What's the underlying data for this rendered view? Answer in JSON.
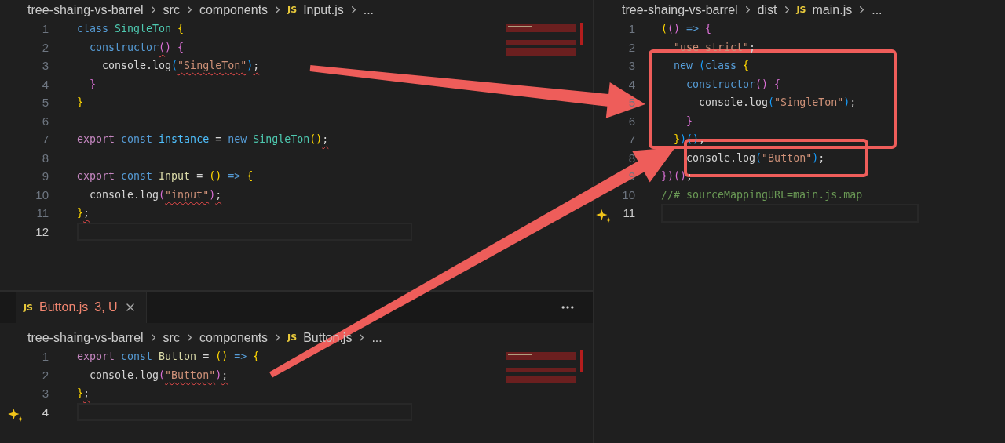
{
  "panes": [
    {
      "breadcrumb": [
        {
          "text": "tree-shaing-vs-barrel"
        },
        {
          "text": "src"
        },
        {
          "text": "components"
        },
        {
          "text": "Input.js",
          "file": "JS"
        },
        {
          "text": "..."
        }
      ],
      "minimap": true,
      "lines": [
        {
          "number": "1",
          "tokens": [
            {
              "text": "class ",
              "kind": "kw"
            },
            {
              "text": "SingleTon ",
              "kind": "cls"
            },
            {
              "text": "{",
              "kind": "p1"
            }
          ]
        },
        {
          "number": "2",
          "tokens": [
            {
              "text": "  constructor",
              "kind": "kw"
            },
            {
              "text": "(",
              "kind": "p2",
              "error": true
            },
            {
              "text": ") {",
              "kind": "p2"
            }
          ]
        },
        {
          "number": "3",
          "tokens": [
            {
              "text": "    console.log",
              "kind": "plain"
            },
            {
              "text": "(",
              "kind": "p3"
            },
            {
              "text": "\"SingleTon\"",
              "kind": "str",
              "error": true
            },
            {
              "text": ")",
              "kind": "p3"
            },
            {
              "text": ";",
              "kind": "plain",
              "error": true
            }
          ]
        },
        {
          "number": "4",
          "tokens": [
            {
              "text": "  }",
              "kind": "p2"
            }
          ]
        },
        {
          "number": "5",
          "tokens": [
            {
              "text": "}",
              "kind": "p1"
            }
          ]
        },
        {
          "number": "6"
        },
        {
          "number": "7",
          "tokens": [
            {
              "text": "export ",
              "kind": "ctrl"
            },
            {
              "text": "const ",
              "kind": "kw"
            },
            {
              "text": "instance",
              "kind": "var"
            },
            {
              "text": " = ",
              "kind": "plain"
            },
            {
              "text": "new ",
              "kind": "kw"
            },
            {
              "text": "SingleTon",
              "kind": "cls"
            },
            {
              "text": "()",
              "kind": "p1"
            },
            {
              "text": ";",
              "kind": "plain",
              "error": true
            }
          ]
        },
        {
          "number": "8"
        },
        {
          "number": "9",
          "tokens": [
            {
              "text": "export ",
              "kind": "ctrl"
            },
            {
              "text": "const ",
              "kind": "kw"
            },
            {
              "text": "Input",
              "kind": "fn"
            },
            {
              "text": " = ",
              "kind": "plain"
            },
            {
              "text": "() ",
              "kind": "p1"
            },
            {
              "text": "=> ",
              "kind": "kw"
            },
            {
              "text": "{",
              "kind": "p1"
            }
          ]
        },
        {
          "number": "10",
          "tokens": [
            {
              "text": "  console.log",
              "kind": "plain"
            },
            {
              "text": "(",
              "kind": "p2"
            },
            {
              "text": "\"input\"",
              "kind": "str",
              "error": true
            },
            {
              "text": ")",
              "kind": "p2"
            },
            {
              "text": ";",
              "kind": "plain",
              "error": true
            }
          ]
        },
        {
          "number": "11",
          "tokens": [
            {
              "text": "}",
              "kind": "p1"
            },
            {
              "text": ";",
              "kind": "plain",
              "error": true
            }
          ]
        },
        {
          "number": "12",
          "current": true
        }
      ]
    },
    {
      "tab": {
        "icon": "JS",
        "name": "Button.js",
        "badge": "3, U",
        "selected": true
      },
      "breadcrumb": [
        {
          "text": "tree-shaing-vs-barrel"
        },
        {
          "text": "src"
        },
        {
          "text": "components"
        },
        {
          "text": "Button.js",
          "file": "JS"
        },
        {
          "text": "..."
        }
      ],
      "minimap": true,
      "lines": [
        {
          "number": "1",
          "tokens": [
            {
              "text": "export ",
              "kind": "ctrl"
            },
            {
              "text": "const ",
              "kind": "kw"
            },
            {
              "text": "Button",
              "kind": "fn"
            },
            {
              "text": " = ",
              "kind": "plain"
            },
            {
              "text": "() ",
              "kind": "p1"
            },
            {
              "text": "=> ",
              "kind": "kw"
            },
            {
              "text": "{",
              "kind": "p1"
            }
          ]
        },
        {
          "number": "2",
          "tokens": [
            {
              "text": "  console.log",
              "kind": "plain"
            },
            {
              "text": "(",
              "kind": "p2"
            },
            {
              "text": "\"Button\"",
              "kind": "str",
              "error": true
            },
            {
              "text": ")",
              "kind": "p2"
            },
            {
              "text": ";",
              "kind": "plain",
              "error": true
            }
          ]
        },
        {
          "number": "3",
          "tokens": [
            {
              "text": "}",
              "kind": "p1"
            },
            {
              "text": ";",
              "kind": "plain",
              "error": true
            }
          ]
        },
        {
          "number": "4",
          "current": true,
          "sparkle": true
        }
      ]
    },
    {
      "breadcrumb": [
        {
          "text": "tree-shaing-vs-barrel"
        },
        {
          "text": "dist"
        },
        {
          "text": "main.js",
          "file": "JS"
        },
        {
          "text": "..."
        }
      ],
      "lines": [
        {
          "number": "1",
          "tokens": [
            {
              "text": "(",
              "kind": "p1"
            },
            {
              "text": "() ",
              "kind": "p2"
            },
            {
              "text": "=> ",
              "kind": "kw"
            },
            {
              "text": "{",
              "kind": "p2"
            }
          ]
        },
        {
          "number": "2",
          "tokens": [
            {
              "text": "  \"use strict\"",
              "kind": "str"
            },
            {
              "text": ";",
              "kind": "plain"
            }
          ]
        },
        {
          "number": "3",
          "tokens": [
            {
              "text": "  new ",
              "kind": "kw"
            },
            {
              "text": "(",
              "kind": "p3"
            },
            {
              "text": "class ",
              "kind": "kw"
            },
            {
              "text": "{",
              "kind": "p1"
            }
          ]
        },
        {
          "number": "4",
          "tokens": [
            {
              "text": "    constructor",
              "kind": "kw"
            },
            {
              "text": "() {",
              "kind": "p2"
            }
          ]
        },
        {
          "number": "5",
          "tokens": [
            {
              "text": "      console.log",
              "kind": "plain"
            },
            {
              "text": "(",
              "kind": "p3"
            },
            {
              "text": "\"SingleTon\"",
              "kind": "str"
            },
            {
              "text": ")",
              "kind": "p3"
            },
            {
              "text": ";",
              "kind": "plain"
            }
          ]
        },
        {
          "number": "6",
          "tokens": [
            {
              "text": "    }",
              "kind": "p2"
            }
          ]
        },
        {
          "number": "7",
          "tokens": [
            {
              "text": "  }",
              "kind": "p1"
            },
            {
              "text": ")()",
              "kind": "p3"
            },
            {
              "text": ",",
              "kind": "plain"
            }
          ]
        },
        {
          "number": "8",
          "tokens": [
            {
              "text": "    console.log",
              "kind": "plain"
            },
            {
              "text": "(",
              "kind": "p3"
            },
            {
              "text": "\"Button\"",
              "kind": "str"
            },
            {
              "text": ")",
              "kind": "p3"
            },
            {
              "text": ";",
              "kind": "plain"
            }
          ]
        },
        {
          "number": "9",
          "tokens": [
            {
              "text": "}",
              "kind": "p2"
            },
            {
              "text": ")()",
              "kind": "p2"
            },
            {
              "text": ";",
              "kind": "plain"
            }
          ]
        },
        {
          "number": "10",
          "tokens": [
            {
              "text": "//# sourceMappingURL=main.js.map",
              "kind": "cmt"
            }
          ]
        },
        {
          "number": "11",
          "current": true,
          "sparkle": true
        }
      ]
    }
  ]
}
